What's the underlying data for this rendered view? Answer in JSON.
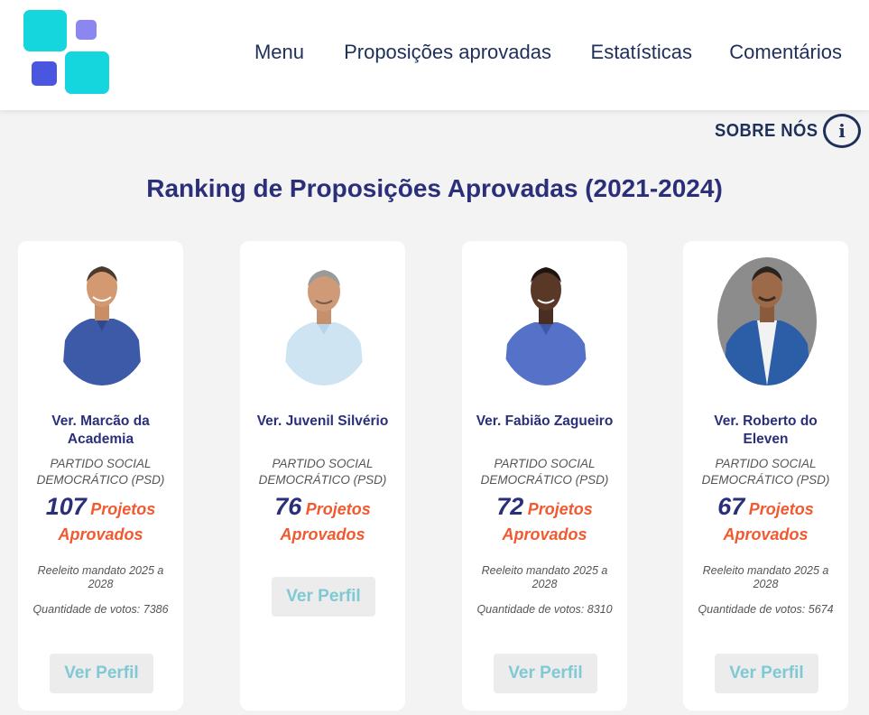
{
  "header": {
    "nav": [
      {
        "label": "Menu"
      },
      {
        "label": "Proposições aprovadas"
      },
      {
        "label": "Estatísticas"
      },
      {
        "label": "Comentários"
      }
    ]
  },
  "about": {
    "label": "SOBRE NÓS",
    "icon": "info-icon",
    "icon_glyph": "i"
  },
  "page_title": "Ranking de Proposições Aprovadas (2021-2024)",
  "colors": {
    "navy": "#2b2f7a",
    "accent_orange": "#f15a30",
    "button_text": "#7ec9d4",
    "logo_cyan": "#14d6dc"
  },
  "cards": [
    {
      "name": "Ver. Marcão da Academia",
      "party": "PARTIDO SOCIAL DEMOCRÁTICO (PSD)",
      "count": "107",
      "count_label": "Projetos Aprovados",
      "reelected": "Reeleito mandato 2025 a 2028",
      "votes": "Quantidade de votos: 7386",
      "button": "Ver Perfil"
    },
    {
      "name": "Ver. Juvenil Silvério",
      "party": "PARTIDO SOCIAL DEMOCRÁTICO (PSD)",
      "count": "76",
      "count_label": "Projetos Aprovados",
      "button": "Ver Perfil"
    },
    {
      "name": "Ver. Fabião Zagueiro",
      "party": "PARTIDO SOCIAL DEMOCRÁTICO (PSD)",
      "count": "72",
      "count_label": "Projetos Aprovados",
      "reelected": "Reeleito mandato 2025 a 2028",
      "votes": "Quantidade de votos: 8310",
      "button": "Ver Perfil"
    },
    {
      "name": "Ver. Roberto do Eleven",
      "party": "PARTIDO SOCIAL DEMOCRÁTICO (PSD)",
      "count": "67",
      "count_label": "Projetos Aprovados",
      "reelected": "Reeleito mandato 2025 a 2028",
      "votes": "Quantidade de votos: 5674",
      "button": "Ver Perfil"
    }
  ]
}
